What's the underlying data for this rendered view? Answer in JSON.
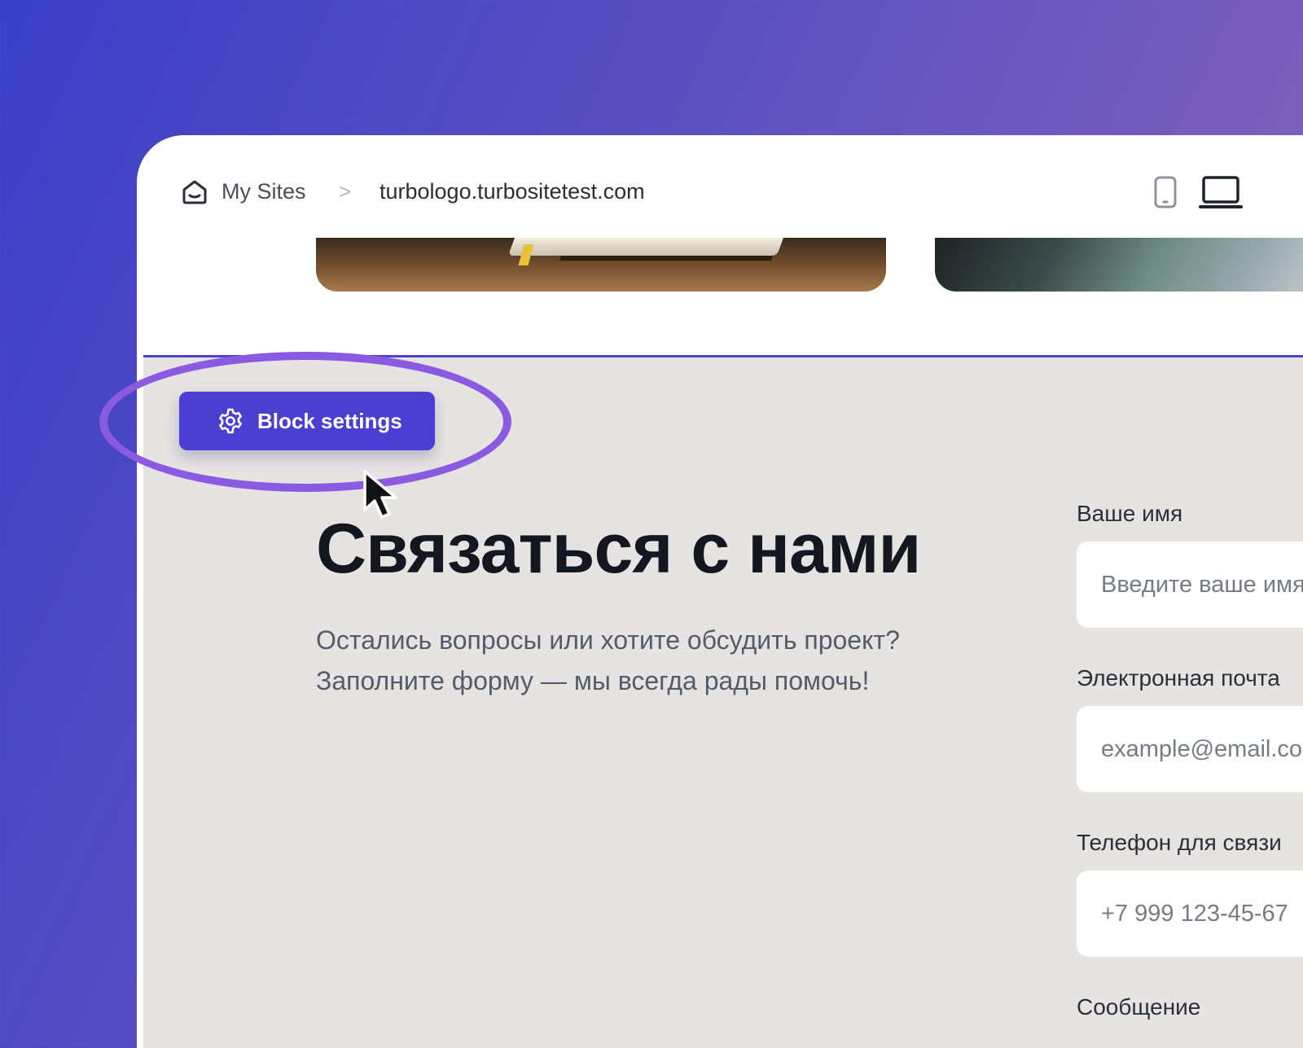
{
  "breadcrumb": {
    "root_label": "My Sites",
    "separator": ">",
    "current_site": "turbologo.turbositetest.com"
  },
  "device_toggle": {
    "mobile_icon": "smartphone-icon",
    "desktop_icon": "laptop-icon",
    "active": "desktop"
  },
  "block_settings": {
    "label": "Block settings",
    "icon": "gear-icon"
  },
  "contact": {
    "heading": "Связаться с нами",
    "description_line1": "Остались вопросы или хотите обсудить проект?",
    "description_line2": "Заполните форму — мы всегда рады помочь!"
  },
  "form": {
    "name_label": "Ваше имя",
    "name_placeholder": "Введите ваше имя",
    "email_label": "Электронная почта",
    "email_placeholder": "example@email.com",
    "phone_label": "Телефон для связи",
    "phone_placeholder": "+7 999 123-45-67",
    "message_label": "Сообщение"
  },
  "colors": {
    "accent": "#4a3fd1",
    "highlight": "#8a5be0",
    "section_bg": "#e6e4e3"
  }
}
